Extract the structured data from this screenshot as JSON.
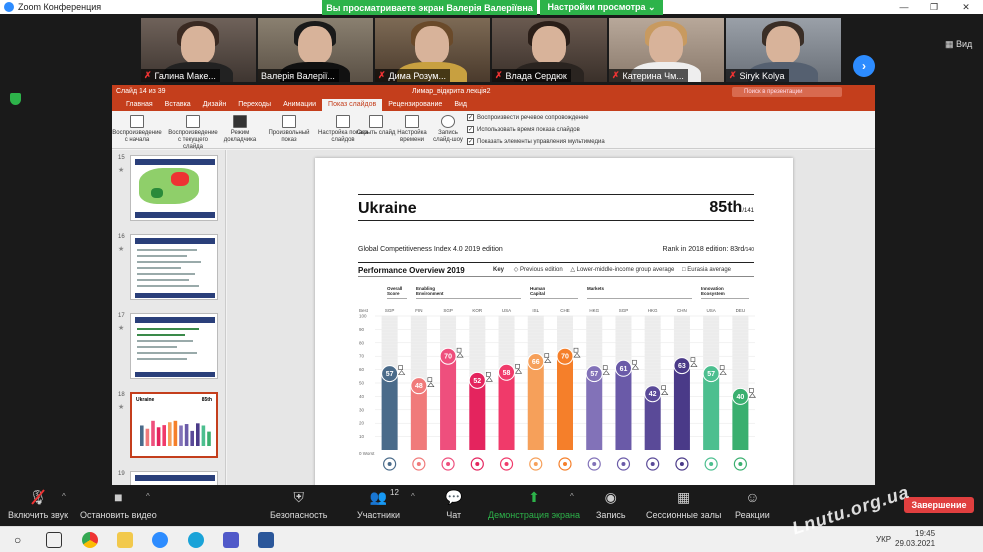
{
  "zoom": {
    "window_title": "Zoom Конференция",
    "banner": "Вы просматриваете экран Валерія Валеріївна",
    "view_options": "Настройки просмотра ⌄",
    "view_button": "Вид",
    "participants": [
      {
        "name": "Галина Маке..."
      },
      {
        "name": "Валерія Валерії..."
      },
      {
        "name": "Дима Розум..."
      },
      {
        "name": "Влада Сердюк"
      },
      {
        "name": "Катерина Чм..."
      },
      {
        "name": "Siryk Kolya"
      }
    ],
    "toolbar": {
      "mute": "Включить звук",
      "video": "Остановить видео",
      "security": "Безопасность",
      "participants": "Участники",
      "participants_count": "12",
      "chat": "Чат",
      "share": "Демонстрация экрана",
      "record": "Запись",
      "breakout": "Сессионные залы",
      "reactions": "Реакции",
      "end": "Завершение"
    }
  },
  "ppt": {
    "slide_counter": "Слайд 14 из 39",
    "filename": "Лимар_відкрита лекція2",
    "search_placeholder": "Поиск в презентации",
    "tabs": [
      "Главная",
      "Вставка",
      "Дизайн",
      "Переходы",
      "Анимации",
      "Показ слайдов",
      "Рецензирование",
      "Вид"
    ],
    "active_tab": 5,
    "ribbon_buttons": [
      "Воспроизведение с начала",
      "Воспроизведение с текущего слайда",
      "Режим докладчика",
      "Произвольный показ",
      "Настройка показа слайдов",
      "Скрыть слайд",
      "Настройка времени",
      "Запись слайд-шоу"
    ],
    "checkboxes": [
      "Воспроизвести речевое сопровождение",
      "Использовать время показа слайдов",
      "Показать элементы управления мультимедиа"
    ],
    "thumb_numbers": [
      "15",
      "16",
      "17",
      "18",
      "19"
    ],
    "selected_thumb": 3,
    "thumb18_title": "Ukraine",
    "thumb18_rank": "85th"
  },
  "slide": {
    "country": "Ukraine",
    "rank": "85th",
    "rank_total": "/141",
    "subtitle": "Global Competitiveness Index 4.0 2019 edition",
    "rank_2018": "Rank in 2018 edition: 83rd",
    "rank_2018_total": "/140",
    "perf_title": "Performance Overview 2019",
    "key_label": "Key",
    "key_items": [
      "◇ Previous edition",
      "△ Lower-middle-income group average",
      "□ Eurasia average"
    ],
    "groups": [
      {
        "label": "Overall Score"
      },
      {
        "label": "Enabling Environment"
      },
      {
        "label": "Human Capital"
      },
      {
        "label": "Markets"
      },
      {
        "label": "Innovation Ecosystem"
      }
    ],
    "y_axis_top": "Best",
    "y_axis_bottom": "0 Worst",
    "y_ticks": [
      "100",
      "90",
      "80",
      "70",
      "60",
      "50",
      "40",
      "30",
      "20",
      "10"
    ]
  },
  "chart_data": {
    "type": "bar",
    "categories": [
      "SGP",
      "FIN",
      "SGP",
      "KOR",
      "USA",
      "ISL",
      "CHE",
      "HKG",
      "SGP",
      "HKG",
      "CHN",
      "USA",
      "DEU"
    ],
    "values": [
      57,
      48,
      70,
      52,
      58,
      66,
      70,
      57,
      61,
      42,
      63,
      57,
      40
    ],
    "colors": [
      "#4a6b8a",
      "#f07a7a",
      "#ee4f7d",
      "#e4245e",
      "#f03a6a",
      "#f6a05a",
      "#f57f2a",
      "#8272b8",
      "#6a5aa8",
      "#5a4a98",
      "#4a3a88",
      "#4cbf8f",
      "#3aaf6f"
    ],
    "ylim": [
      0,
      100
    ],
    "ylabel": "",
    "title": "Performance Overview 2019"
  },
  "colors": {
    "ppt_accent": "#c43e1c",
    "zoom_green": "#2db34a",
    "zoom_blue": "#2d8cff",
    "end_red": "#e03f3f"
  },
  "taskbar": {
    "lang": "УКР",
    "time": "19:45",
    "date": "29.03.2021"
  },
  "watermark": "Lnutu.org.ua"
}
